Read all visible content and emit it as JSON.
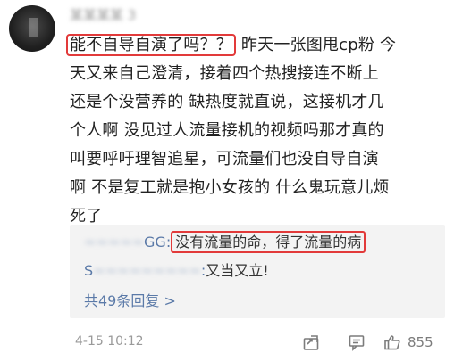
{
  "comment": {
    "highlight": "能不自导自演了吗？？",
    "line1_rest": " 昨天一张图甩cp粉 今",
    "line2": "天又来自己澄清，接着四个热搜接连不断上",
    "line3": "还是个没营养的 缺热度就直说，这接机才几",
    "line4": "个人啊 没见过人流量接机的视频吗那才真的",
    "line5": "叫要呼吁理智追星，可流量们也没自导自演",
    "line6": "啊 不是复工就是抱小女孩的 什么鬼玩意儿烦",
    "line7": "死了"
  },
  "replies": [
    {
      "name_blur": "~~~~~",
      "name_suffix": "GG:",
      "text": "没有流量的命，得了流量的病"
    },
    {
      "name_prefix": "S",
      "name_blur": "~~~~~~~~~",
      "name_suffix": ":",
      "text": "又当又立!"
    }
  ],
  "more_replies": "共49条回复 >",
  "footer": {
    "time": "4-15 10:12",
    "likes": "855"
  },
  "icons": [
    "share-icon",
    "comment-icon",
    "like-icon"
  ],
  "colors": {
    "highlight_border": "#e23a3a",
    "link": "#5b7aa8"
  }
}
